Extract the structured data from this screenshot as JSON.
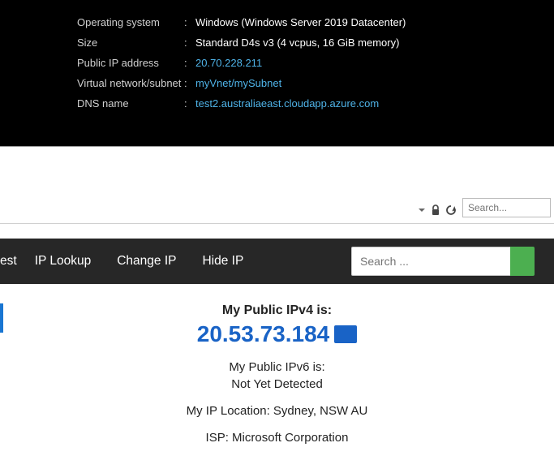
{
  "vm_properties": {
    "os": {
      "label": "Operating system",
      "value": "Windows (Windows Server 2019 Datacenter)"
    },
    "size": {
      "label": "Size",
      "value": "Standard D4s v3 (4 vcpus, 16 GiB memory)"
    },
    "public_ip": {
      "label": "Public IP address",
      "value": "20.70.228.211"
    },
    "vnet": {
      "label": "Virtual network/subnet",
      "value": "myVnet/mySubnet"
    },
    "dns": {
      "label": "DNS name",
      "value": "test2.australiaeast.cloudapp.azure.com"
    }
  },
  "browser_search_placeholder": "Search...",
  "nav": {
    "items": [
      "est",
      "IP Lookup",
      "Change IP",
      "Hide IP"
    ],
    "search_placeholder": "Search ..."
  },
  "content": {
    "ipv4_title": "My Public IPv4 is:",
    "ipv4_value": "20.53.73.184",
    "ipv6_title": "My Public IPv6 is:",
    "ipv6_value": "Not Yet Detected",
    "location": "My IP Location: Sydney, NSW AU",
    "isp": "ISP: Microsoft Corporation"
  }
}
